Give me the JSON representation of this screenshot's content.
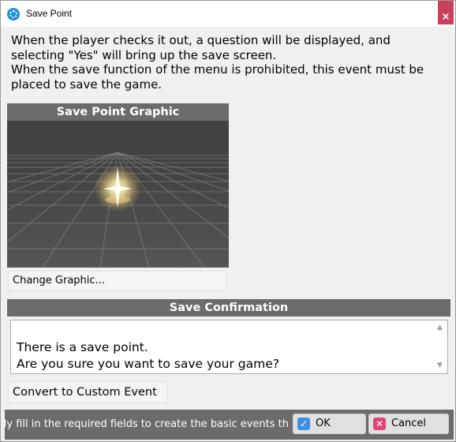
{
  "window": {
    "title": "Save Point",
    "close_symbol": "×"
  },
  "description": "When the player checks it out, a question will be displayed, and selecting \"Yes\" will bring up the save screen.\nWhen the save function of the menu is prohibited, this event must be placed to save the game.",
  "graphic": {
    "header": "Save Point Graphic",
    "change_button": "Change Graphic..."
  },
  "confirmation": {
    "header": "Save Confirmation",
    "text": "There is a save point.\nAre you sure you want to save your game?"
  },
  "convert_button": "Convert to Custom Event",
  "footer": {
    "hint": "ly fill in the required fields to create the basic events th",
    "ok": "OK",
    "cancel": "Cancel"
  },
  "icons": {
    "app": "app-icon",
    "close": "close-icon",
    "ok": "check-icon",
    "cancel": "x-icon",
    "scroll_up": "scroll-up-icon",
    "scroll_down": "scroll-down-icon"
  },
  "colors": {
    "header_bg": "#6b6b6b",
    "close_bg": "#c9405d",
    "ok_icon": "#3f8fe0",
    "cancel_icon": "#e0457a"
  }
}
